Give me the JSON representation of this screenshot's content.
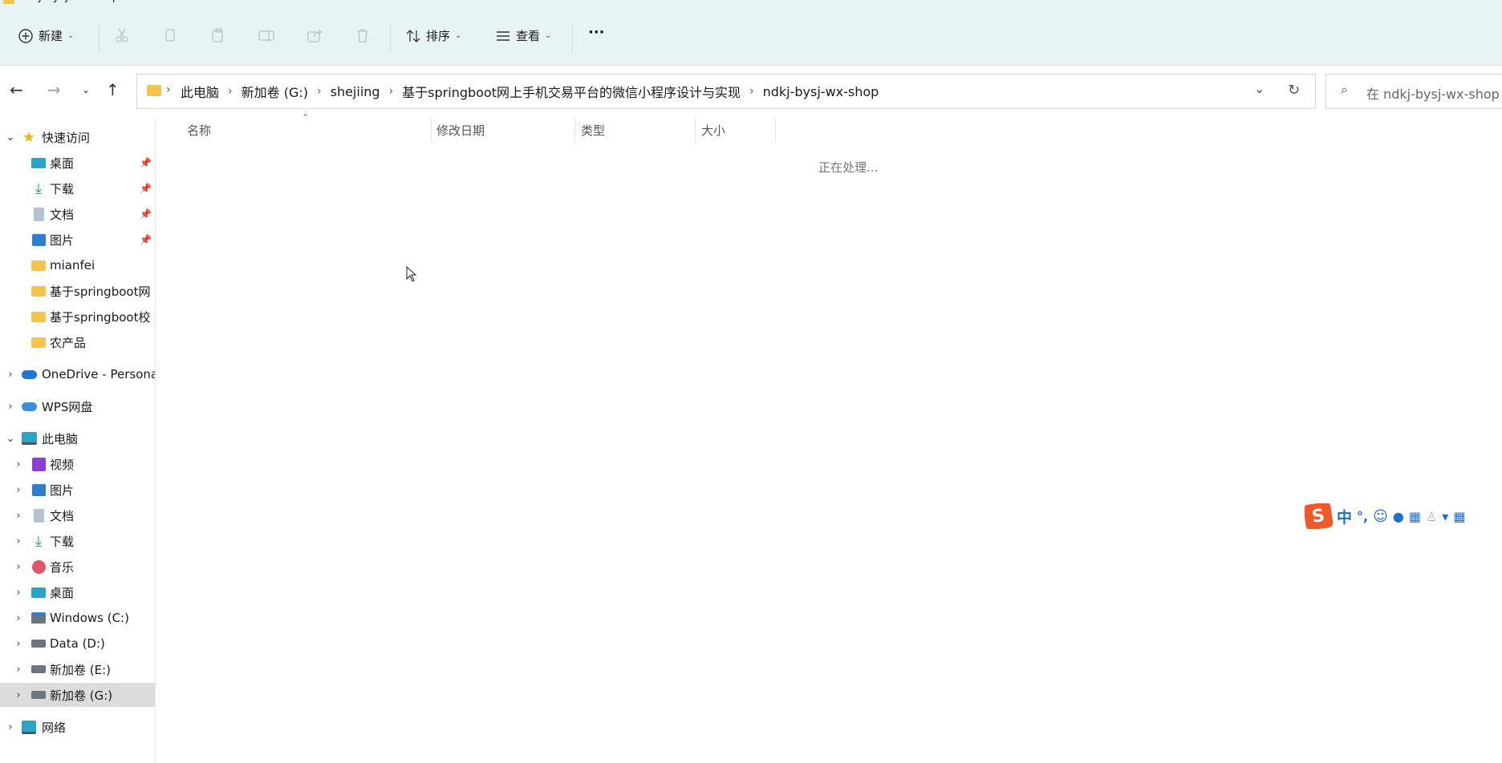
{
  "window": {
    "title": "ndkj-bysj-wx-shop"
  },
  "toolbar": {
    "new_label": "新建",
    "sort_label": "排序",
    "view_label": "查看",
    "more_label": "···"
  },
  "address": {
    "crumbs": [
      "此电脑",
      "新加卷 (G:)",
      "shejiing",
      "基于springboot网上手机交易平台的微信小程序设计与实现",
      "ndkj-bysj-wx-shop"
    ]
  },
  "search": {
    "placeholder": "在 ndkj-bysj-wx-shop 中"
  },
  "sidebar": {
    "quick_access": "快速访问",
    "quick_items": [
      "桌面",
      "下载",
      "文档",
      "图片",
      "mianfei",
      "基于springboot网",
      "基于springboot校",
      "农产品"
    ],
    "onedrive": "OneDrive - Persona",
    "wps": "WPS网盘",
    "this_pc": "此电脑",
    "pc_items": [
      "视频",
      "图片",
      "文档",
      "下载",
      "音乐",
      "桌面",
      "Windows (C:)",
      "Data (D:)",
      "新加卷 (E:)",
      "新加卷 (G:)"
    ],
    "network": "网络"
  },
  "columns": {
    "name": "名称",
    "modified": "修改日期",
    "type": "类型",
    "size": "大小"
  },
  "status": {
    "processing": "正在处理..."
  },
  "ime": {
    "mode": "中",
    "punct": "°,"
  },
  "colors": {
    "toolbar_bg": "#e8f3f5",
    "folder": "#f5c44b",
    "selected_bg": "#dcdcdc",
    "ime_logo": "#ef5a28"
  }
}
